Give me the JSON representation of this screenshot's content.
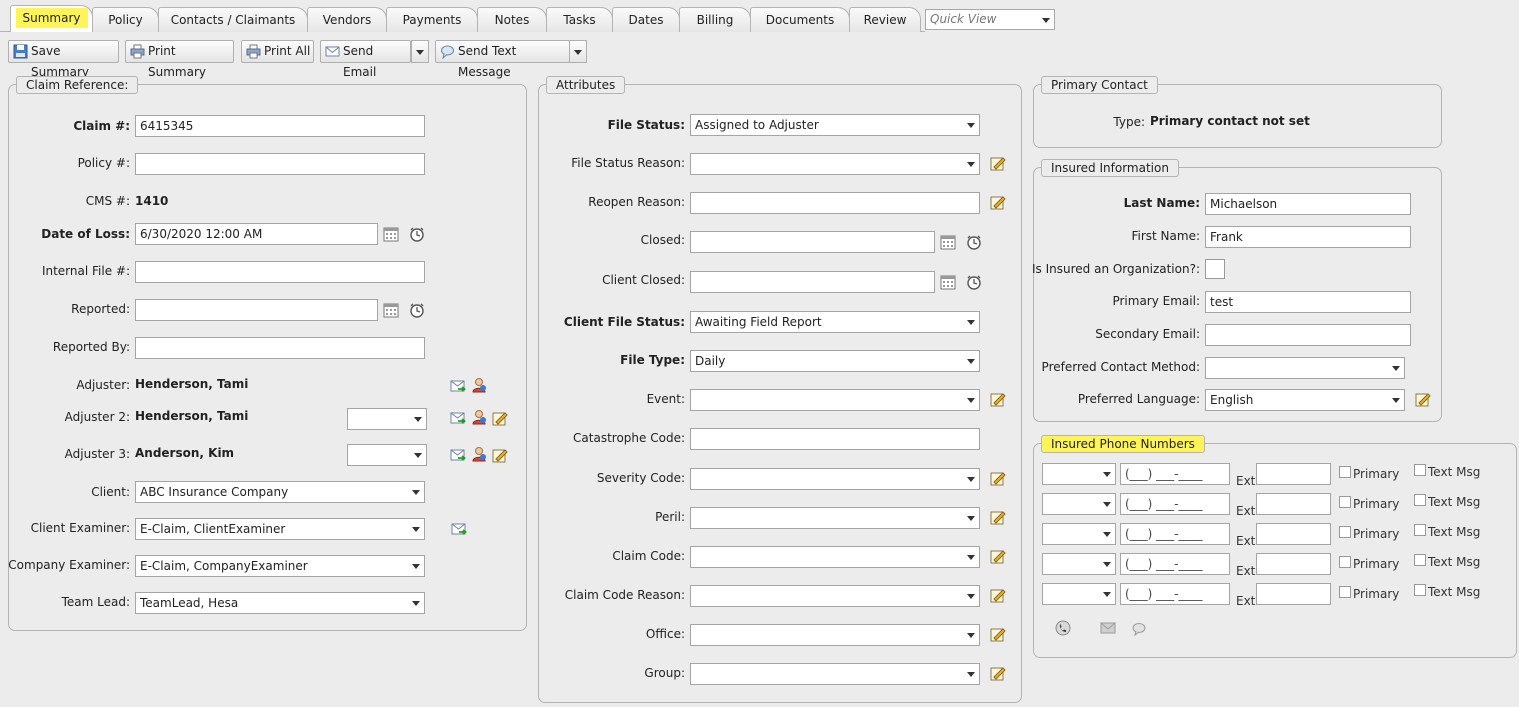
{
  "tabs": [
    {
      "label": "Summary",
      "active": true
    },
    {
      "label": "Policy"
    },
    {
      "label": "Contacts / Claimants"
    },
    {
      "label": "Vendors"
    },
    {
      "label": "Payments"
    },
    {
      "label": "Notes"
    },
    {
      "label": "Tasks"
    },
    {
      "label": "Dates"
    },
    {
      "label": "Billing"
    },
    {
      "label": "Documents"
    },
    {
      "label": "Review"
    }
  ],
  "quick_view": {
    "placeholder": "Quick View"
  },
  "toolbar": {
    "save_summary": "Save Summary",
    "print_summary": "Print Summary",
    "print_all": "Print All",
    "send_email": "Send Email",
    "send_text": "Send Text Message"
  },
  "claim_reference": {
    "title": "Claim Reference:",
    "claim_no_label": "Claim #:",
    "claim_no": "6415345",
    "policy_no_label": "Policy #:",
    "policy_no": "",
    "cms_label": "CMS #:",
    "cms": "1410",
    "date_of_loss_label": "Date of Loss:",
    "date_of_loss": "6/30/2020 12:00 AM",
    "internal_file_label": "Internal File #:",
    "internal_file": "",
    "reported_label": "Reported:",
    "reported": "",
    "reported_by_label": "Reported By:",
    "reported_by": "",
    "adjuster_label": "Adjuster:",
    "adjuster": "Henderson, Tami",
    "adjuster2_label": "Adjuster 2:",
    "adjuster2": "Henderson, Tami",
    "adjuster3_label": "Adjuster 3:",
    "adjuster3": "Anderson, Kim",
    "client_label": "Client:",
    "client": "ABC Insurance Company",
    "client_examiner_label": "Client Examiner:",
    "client_examiner": "E-Claim, ClientExaminer",
    "company_examiner_label": "Company Examiner:",
    "company_examiner": "E-Claim, CompanyExaminer",
    "team_lead_label": "Team Lead:",
    "team_lead": "TeamLead, Hesa"
  },
  "attributes": {
    "title": "Attributes",
    "file_status_label": "File Status:",
    "file_status": "Assigned to Adjuster",
    "file_status_reason_label": "File Status Reason:",
    "file_status_reason": "",
    "reopen_reason_label": "Reopen Reason:",
    "reopen_reason": "",
    "closed_label": "Closed:",
    "closed": "",
    "client_closed_label": "Client Closed:",
    "client_closed": "",
    "client_file_status_label": "Client File Status:",
    "client_file_status": "Awaiting Field Report",
    "file_type_label": "File Type:",
    "file_type": "Daily",
    "event_label": "Event:",
    "event": "",
    "catastrophe_code_label": "Catastrophe Code:",
    "catastrophe_code": "",
    "severity_code_label": "Severity Code:",
    "severity_code": "",
    "peril_label": "Peril:",
    "peril": "",
    "claim_code_label": "Claim Code:",
    "claim_code": "",
    "claim_code_reason_label": "Claim Code Reason:",
    "claim_code_reason": "",
    "office_label": "Office:",
    "office": "",
    "group_label": "Group:",
    "group": ""
  },
  "primary_contact": {
    "title": "Primary Contact",
    "type_label": "Type:",
    "type_value": "Primary contact not set"
  },
  "insured_information": {
    "title": "Insured Information",
    "last_name_label": "Last Name:",
    "last_name": "Michaelson",
    "first_name_label": "First Name:",
    "first_name": "Frank",
    "is_org_label": "Is Insured an Organization?:",
    "primary_email_label": "Primary Email:",
    "primary_email": "test",
    "secondary_email_label": "Secondary Email:",
    "secondary_email": "",
    "preferred_contact_label": "Preferred Contact Method:",
    "preferred_contact": "",
    "preferred_language_label": "Preferred Language:",
    "preferred_language": "English"
  },
  "insured_phone_numbers": {
    "title": "Insured Phone Numbers",
    "phone_mask": "(___) ___-____",
    "ext_label": "Ext:",
    "primary_label": "Primary",
    "text_msg_label": "Text Msg"
  }
}
